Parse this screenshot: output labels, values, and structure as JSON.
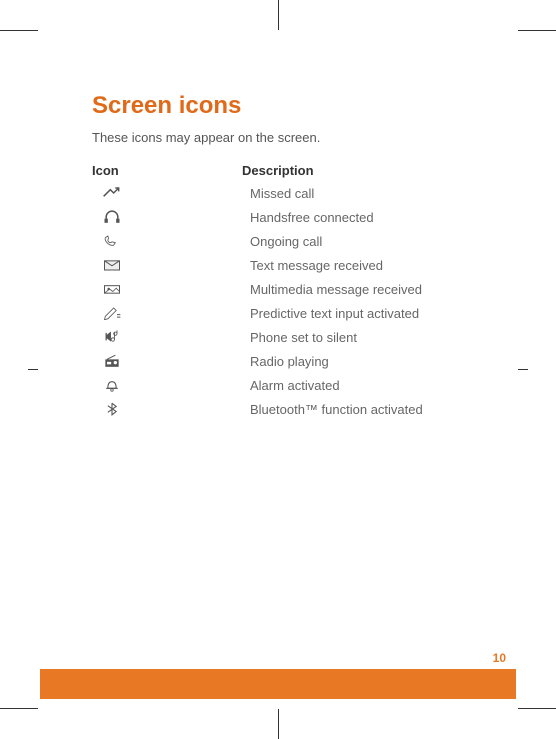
{
  "title": "Screen icons",
  "intro": "These icons may appear on the screen.",
  "headers": {
    "icon": "Icon",
    "description": "Description"
  },
  "rows": [
    {
      "name": "missed-call-icon",
      "desc": "Missed call"
    },
    {
      "name": "headset-icon",
      "desc": "Handsfree connected"
    },
    {
      "name": "phone-icon",
      "desc": "Ongoing call"
    },
    {
      "name": "envelope-icon",
      "desc": "Text message received"
    },
    {
      "name": "mms-icon",
      "desc": "Multimedia message received"
    },
    {
      "name": "pencil-icon",
      "desc": "Predictive text input activated"
    },
    {
      "name": "silent-icon",
      "desc": "Phone set to silent"
    },
    {
      "name": "radio-icon",
      "desc": "Radio playing"
    },
    {
      "name": "alarm-icon",
      "desc": "Alarm activated"
    },
    {
      "name": "bluetooth-icon",
      "desc": "Bluetooth™ function activated"
    }
  ],
  "page_number": "10"
}
